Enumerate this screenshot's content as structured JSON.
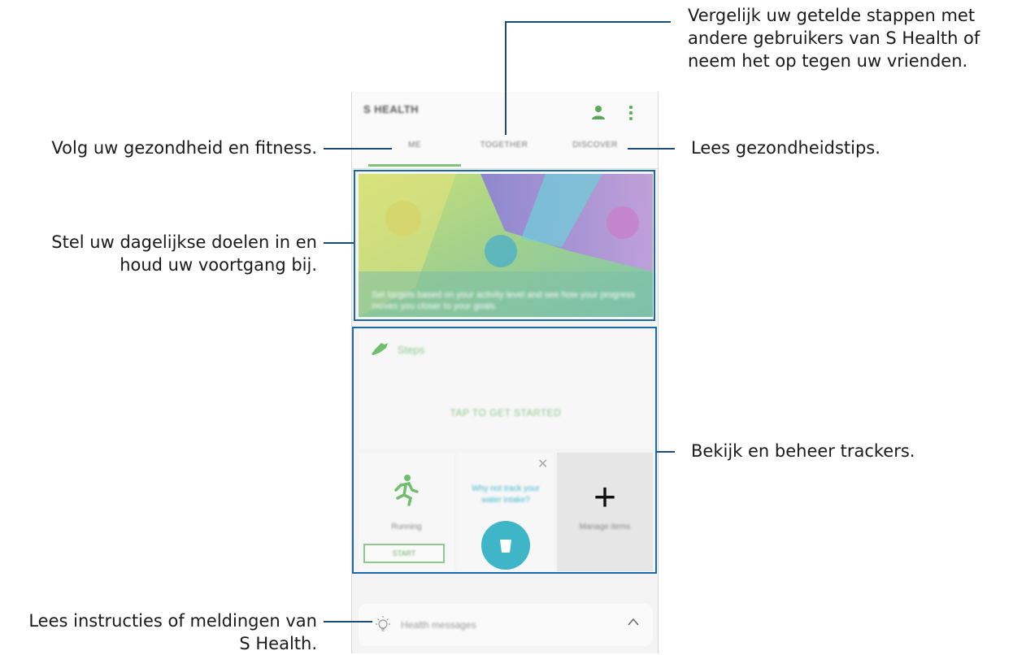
{
  "annotations": {
    "compare_steps": "Vergelijk uw getelde stappen met\nandere gebruikers van S Health of\nneem het op tegen uw vrienden.",
    "track_health": "Volg uw gezondheid en fitness.",
    "health_tips": "Lees gezondheidstips.",
    "daily_goals": "Stel uw dagelijkse doelen in en\nhoud uw voortgang bij.",
    "manage_trackers": "Bekijk en beheer trackers.",
    "read_messages": "Lees instructies of meldingen van\nS Health."
  },
  "app": {
    "title": "S HEALTH",
    "tabs": [
      "ME",
      "TOGETHER",
      "DISCOVER"
    ],
    "active_tab": "ME"
  },
  "hero": {
    "text": "Set targets based on your activity level and see how your progress moves you closer to your goals."
  },
  "steps": {
    "label": "Steps",
    "cta": "TAP TO GET STARTED"
  },
  "trackers": {
    "running_label": "Running",
    "start_label": "START",
    "water_question": "Why not track your water intake?",
    "manage_label": "Manage items"
  },
  "health_messages": {
    "label": "Health messages"
  },
  "colors": {
    "accent_green": "#7dc47a",
    "water_blue": "#3eb6c8",
    "highlight_box": "#1b6aa8"
  }
}
